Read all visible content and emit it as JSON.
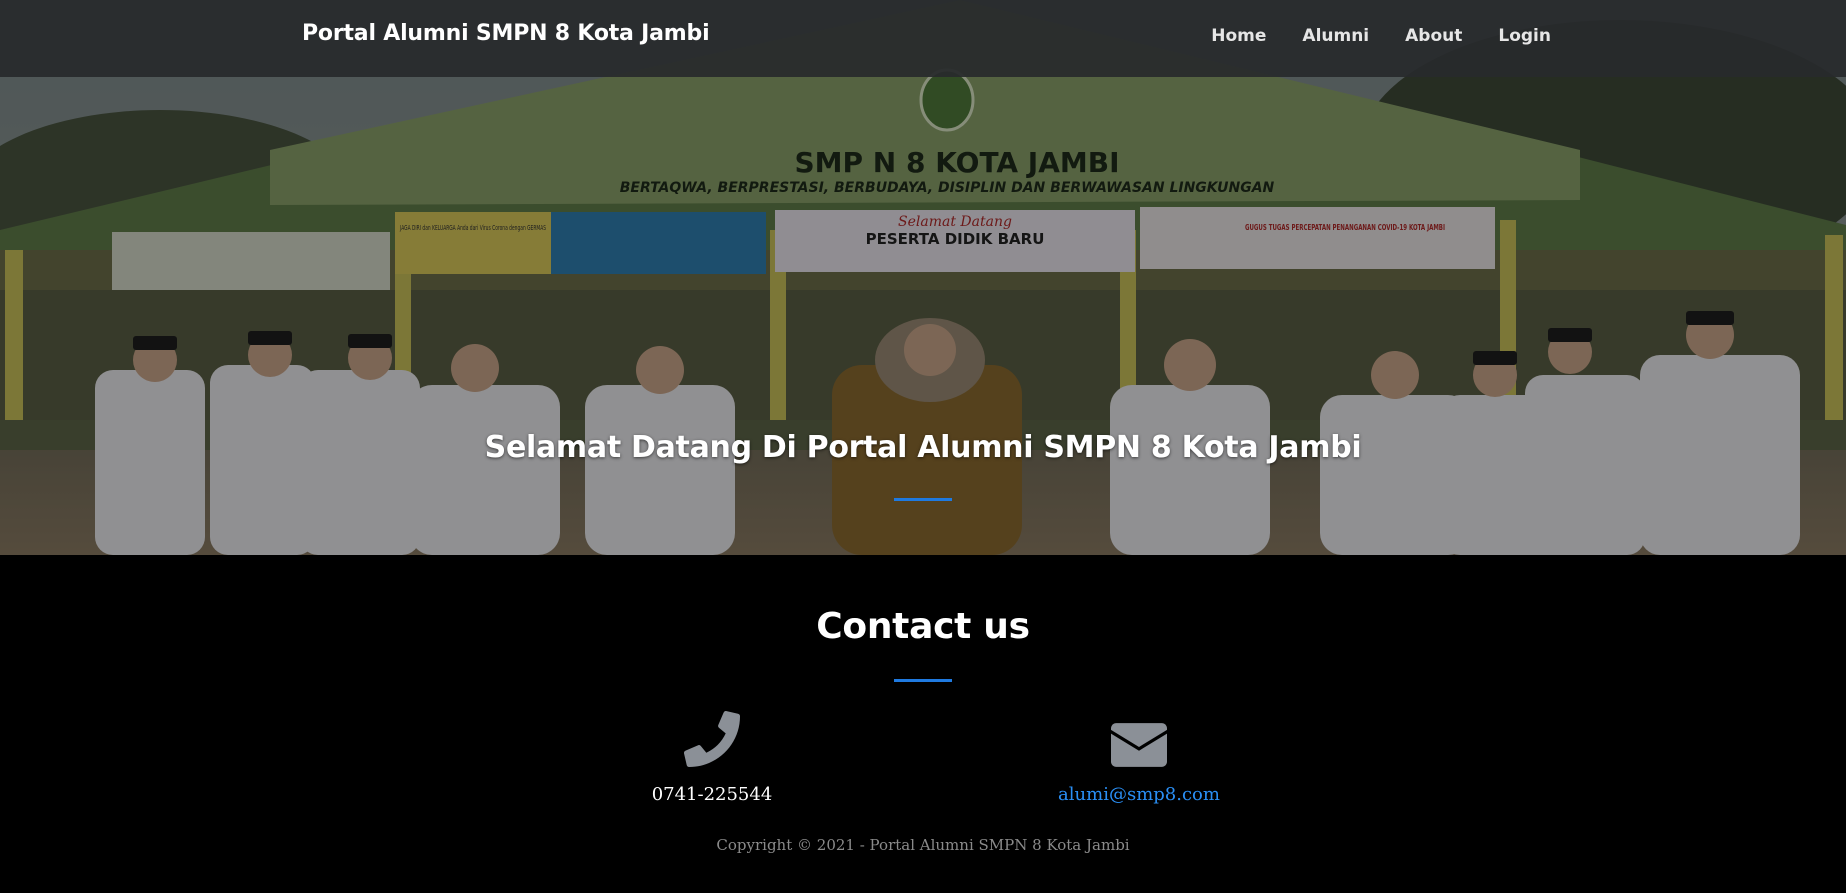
{
  "navbar": {
    "brand": "Portal Alumni SMPN 8 Kota Jambi",
    "links": [
      "Home",
      "Alumni",
      "About",
      "Login"
    ]
  },
  "hero": {
    "title": "Selamat Datang Di Portal Alumni SMPN 8 Kota Jambi",
    "building_sign": "SMP N 8 KOTA JAMBI",
    "building_motto": "BERTAQWA, BERPRESTASI, BERBUDAYA, DISIPLIN DAN BERWAWASAN LINGKUNGAN",
    "banner_center_title": "Selamat Datang",
    "banner_center_subtitle": "PESERTA DIDIK BARU",
    "banner_right_title": "GUGUS TUGAS PERCEPATAN PENANGANAN COVID-19 KOTA JAMBI",
    "banner_left_text": "JAGA DIRI dan KELUARGA Anda dari Virus Corona dengan GERMAS"
  },
  "contact": {
    "title": "Contact us",
    "phone": "0741-225544",
    "email": "alumi@smp8.com",
    "phone_icon": "phone-icon",
    "email_icon": "envelope-icon"
  },
  "footer": {
    "copyright": "Copyright © 2021 - Portal Alumni SMPN 8 Kota Jambi"
  },
  "colors": {
    "accent": "#1f7ae0",
    "link": "#2a8ff5",
    "navbar_bg": "#282a2c",
    "footer_bg": "#000000"
  }
}
